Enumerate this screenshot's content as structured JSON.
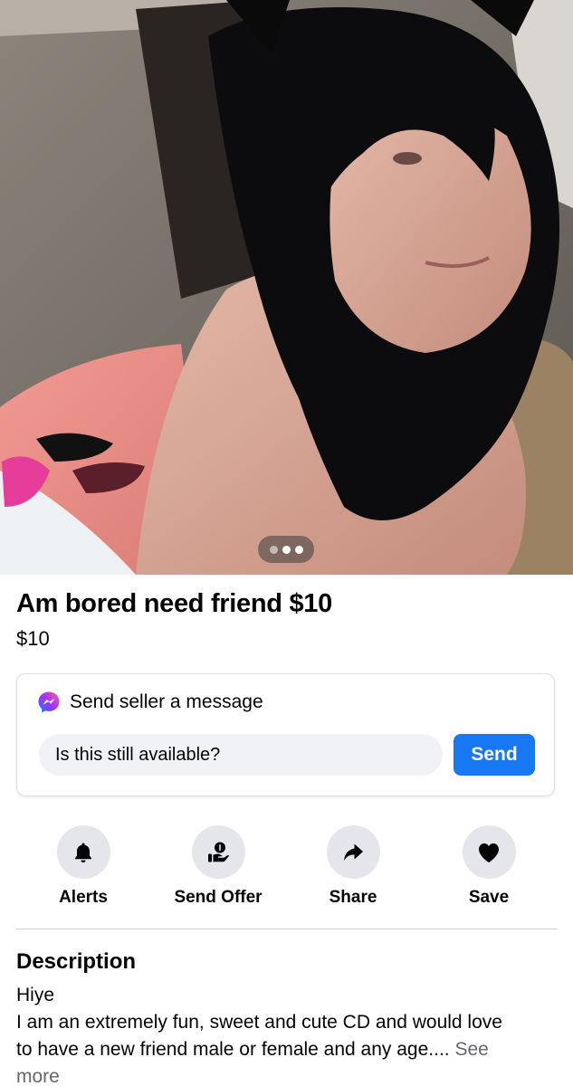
{
  "listing": {
    "title": "Am bored need friend $10",
    "price": "$10",
    "photo_pager": {
      "count": 3,
      "active_index": 1
    }
  },
  "message_card": {
    "icon": "messenger-icon",
    "heading": "Send seller a message",
    "input_value": "Is this still available?",
    "send_label": "Send"
  },
  "actions": [
    {
      "label": "Alerts",
      "icon": "bell-icon"
    },
    {
      "label": "Send Offer",
      "icon": "offer-icon"
    },
    {
      "label": "Share",
      "icon": "share-arrow-icon"
    },
    {
      "label": "Save",
      "icon": "heart-icon"
    }
  ],
  "description": {
    "heading": "Description",
    "line1": "Hiye",
    "line2": "I am an extremely fun, sweet and cute CD and would love",
    "line3": "to have a new friend male or female and any age....",
    "see_more_1": "See",
    "see_more_2": "more"
  },
  "colors": {
    "accent": "#1877f2",
    "action_circle": "#e4e6eb",
    "input_bg": "#f0f2f5",
    "secondary_text": "#65676b"
  }
}
